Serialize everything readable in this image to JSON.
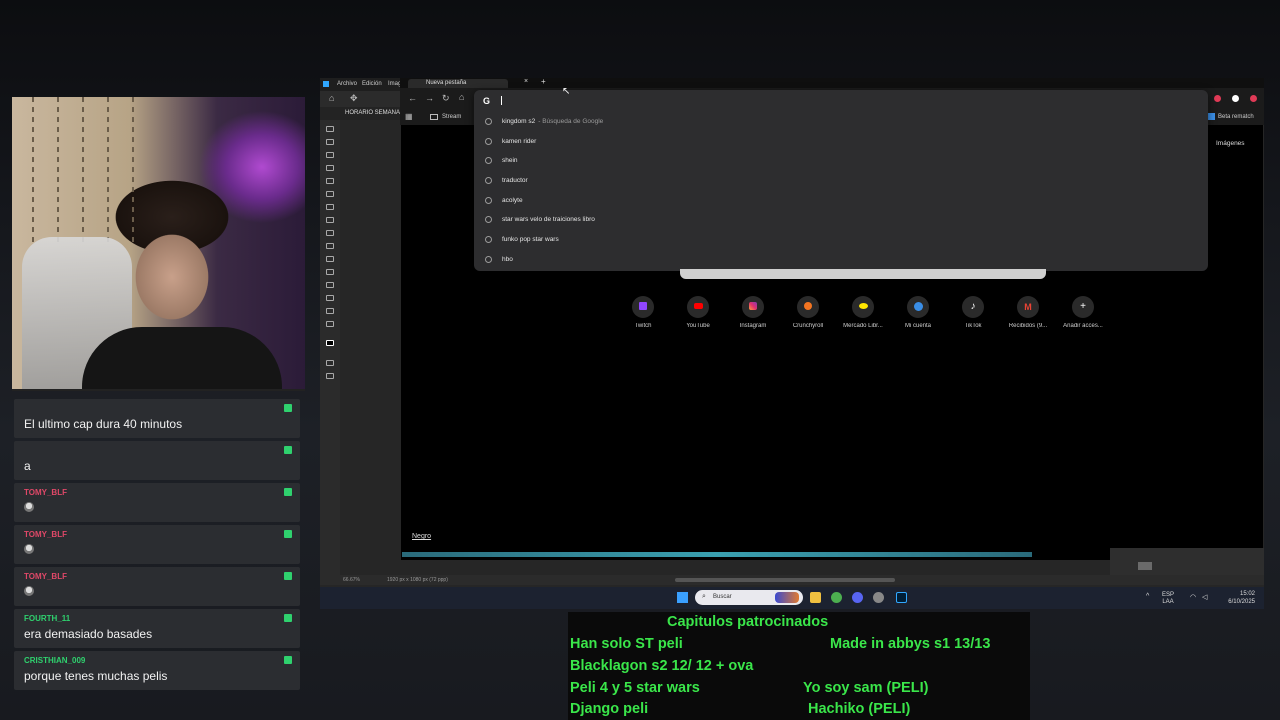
{
  "chat": {
    "messages": [
      {
        "user": "",
        "text": "El ultimo cap dura 40 minutos",
        "user_color": "red"
      },
      {
        "user": "",
        "text": "a",
        "user_color": "red"
      },
      {
        "user": "TOMY_BLF",
        "text": "",
        "emote": "face-emote"
      },
      {
        "user": "TOMY_BLF",
        "text": "",
        "emote": "face-emote"
      },
      {
        "user": "TOMY_BLF",
        "text": "",
        "emote": "face-emote"
      },
      {
        "user": "FOURTH_11",
        "text": "era demasiado basades"
      },
      {
        "user": "CRISTHIAN_009",
        "text": "porque tenes muchas pelis"
      }
    ]
  },
  "photoshop": {
    "menu": [
      "Archivo",
      "Edición",
      "Imag"
    ],
    "doc_tab": "HORARIO SEMANAL",
    "layer_label": "Negro",
    "zoom": "66.67%",
    "doc_info": "1920 px x 1080 px (72 ppp)"
  },
  "browser": {
    "tab_title": "Nueva pestaña",
    "bookmark": "Stream",
    "right_bookmark": "Beta rematch",
    "images_link": "Imágenes",
    "omnibox_text": "",
    "suggestions": [
      {
        "text": "kingdom s2",
        "sub": "- Búsqueda de Google"
      },
      {
        "text": "kamen rider",
        "sub": ""
      },
      {
        "text": "shein",
        "sub": ""
      },
      {
        "text": "traductor",
        "sub": ""
      },
      {
        "text": "acolyte",
        "sub": ""
      },
      {
        "text": "star wars velo de traiciones libro",
        "sub": ""
      },
      {
        "text": "funko pop star wars",
        "sub": ""
      },
      {
        "text": "hbo",
        "sub": ""
      }
    ],
    "shortcuts": [
      {
        "label": "Twitch",
        "color": "#9146ff",
        "icon": "twitch-icon"
      },
      {
        "label": "YouTube",
        "color": "#ff0000",
        "icon": "youtube-icon"
      },
      {
        "label": "Instagram",
        "color": "#e1306c",
        "icon": "instagram-icon"
      },
      {
        "label": "Crunchyroll",
        "color": "#f47521",
        "icon": "crunchyroll-icon"
      },
      {
        "label": "Mercado Libr...",
        "color": "#ffe600",
        "icon": "mercadolibre-icon"
      },
      {
        "label": "Mi cuenta",
        "color": "#3a8ee6",
        "icon": "account-icon"
      },
      {
        "label": "TikTok",
        "color": "#ffffff",
        "icon": "tiktok-icon"
      },
      {
        "label": "Recibidos (9...",
        "color": "#ea4335",
        "icon": "gmail-icon"
      },
      {
        "label": "Añadir acces...",
        "color": "#ffffff",
        "icon": "plus-icon"
      }
    ]
  },
  "taskbar": {
    "search_placeholder": "Buscar",
    "lang": "ESP",
    "lang2": "LAA",
    "time": "15:02",
    "date": "6/10/2025"
  },
  "sponsored": {
    "title": "Capitulos patrocinados",
    "left": [
      "Han solo ST peli",
      "Blacklagon s2 12/ 12 + ova",
      "Peli 4  y 5 star wars",
      "Django peli"
    ],
    "right": [
      "Made in abbys s1 13/13",
      "",
      "Yo soy sam (PELI)",
      "Hachiko (PELI)"
    ]
  }
}
